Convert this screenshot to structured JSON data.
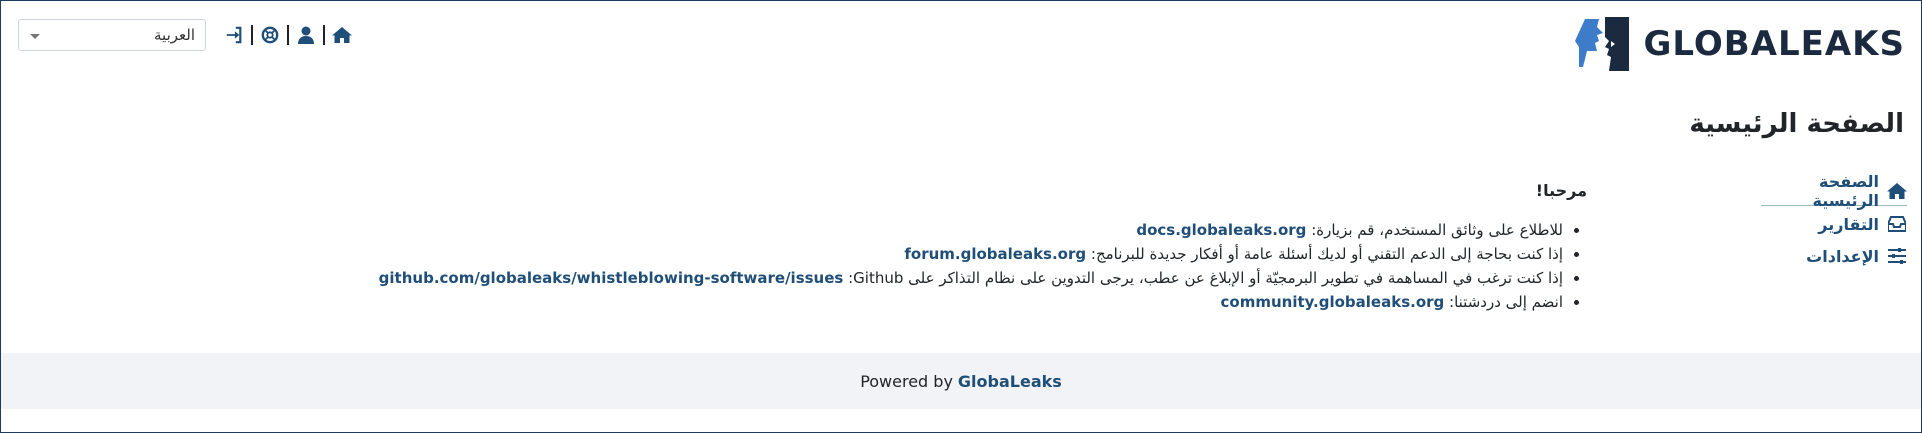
{
  "header": {
    "language": {
      "value": "العربية"
    },
    "nav_icons": [
      "home-icon",
      "user-icon",
      "support-icon",
      "logout-icon"
    ],
    "logo": {
      "wordmark": "GLOBALEAKS"
    }
  },
  "page": {
    "title": "الصفحة الرئيسية"
  },
  "sidebar": {
    "items": [
      {
        "label": "الصفحة الرئيسية",
        "icon": "home-icon"
      },
      {
        "label": "التقارير",
        "icon": "inbox-icon"
      },
      {
        "label": "الإعدادات",
        "icon": "sliders-icon"
      }
    ]
  },
  "main": {
    "welcome": "مرحبا!",
    "items": [
      {
        "text": "للاطلاع على وثائق المستخدم، قم بزيارة: ",
        "link": "docs.globaleaks.org"
      },
      {
        "text": "إذا كنت بحاجة إلى الدعم التقني أو لديك أسئلة عامة أو أفكار جديدة للبرنامج: ",
        "link": "forum.globaleaks.org"
      },
      {
        "text": "إذا كنت ترغب في المساهمة في تطوير البرمجيّة أو الإبلاغ عن عطب، يرجى التدوين على نظام التذاكر على Github: ",
        "link": "github.com/globaleaks/whistleblowing-software/issues"
      },
      {
        "text": "انضم إلى دردشتنا: ",
        "link": "community.globaleaks.org"
      }
    ]
  },
  "footer": {
    "powered_by": "Powered by",
    "brand": "GlobaLeaks"
  },
  "colors": {
    "link": "#1f4e79",
    "footer_bg": "#f1f3f6",
    "logo_blue": "#3d7cc9",
    "logo_dark": "#1b2a3f"
  }
}
